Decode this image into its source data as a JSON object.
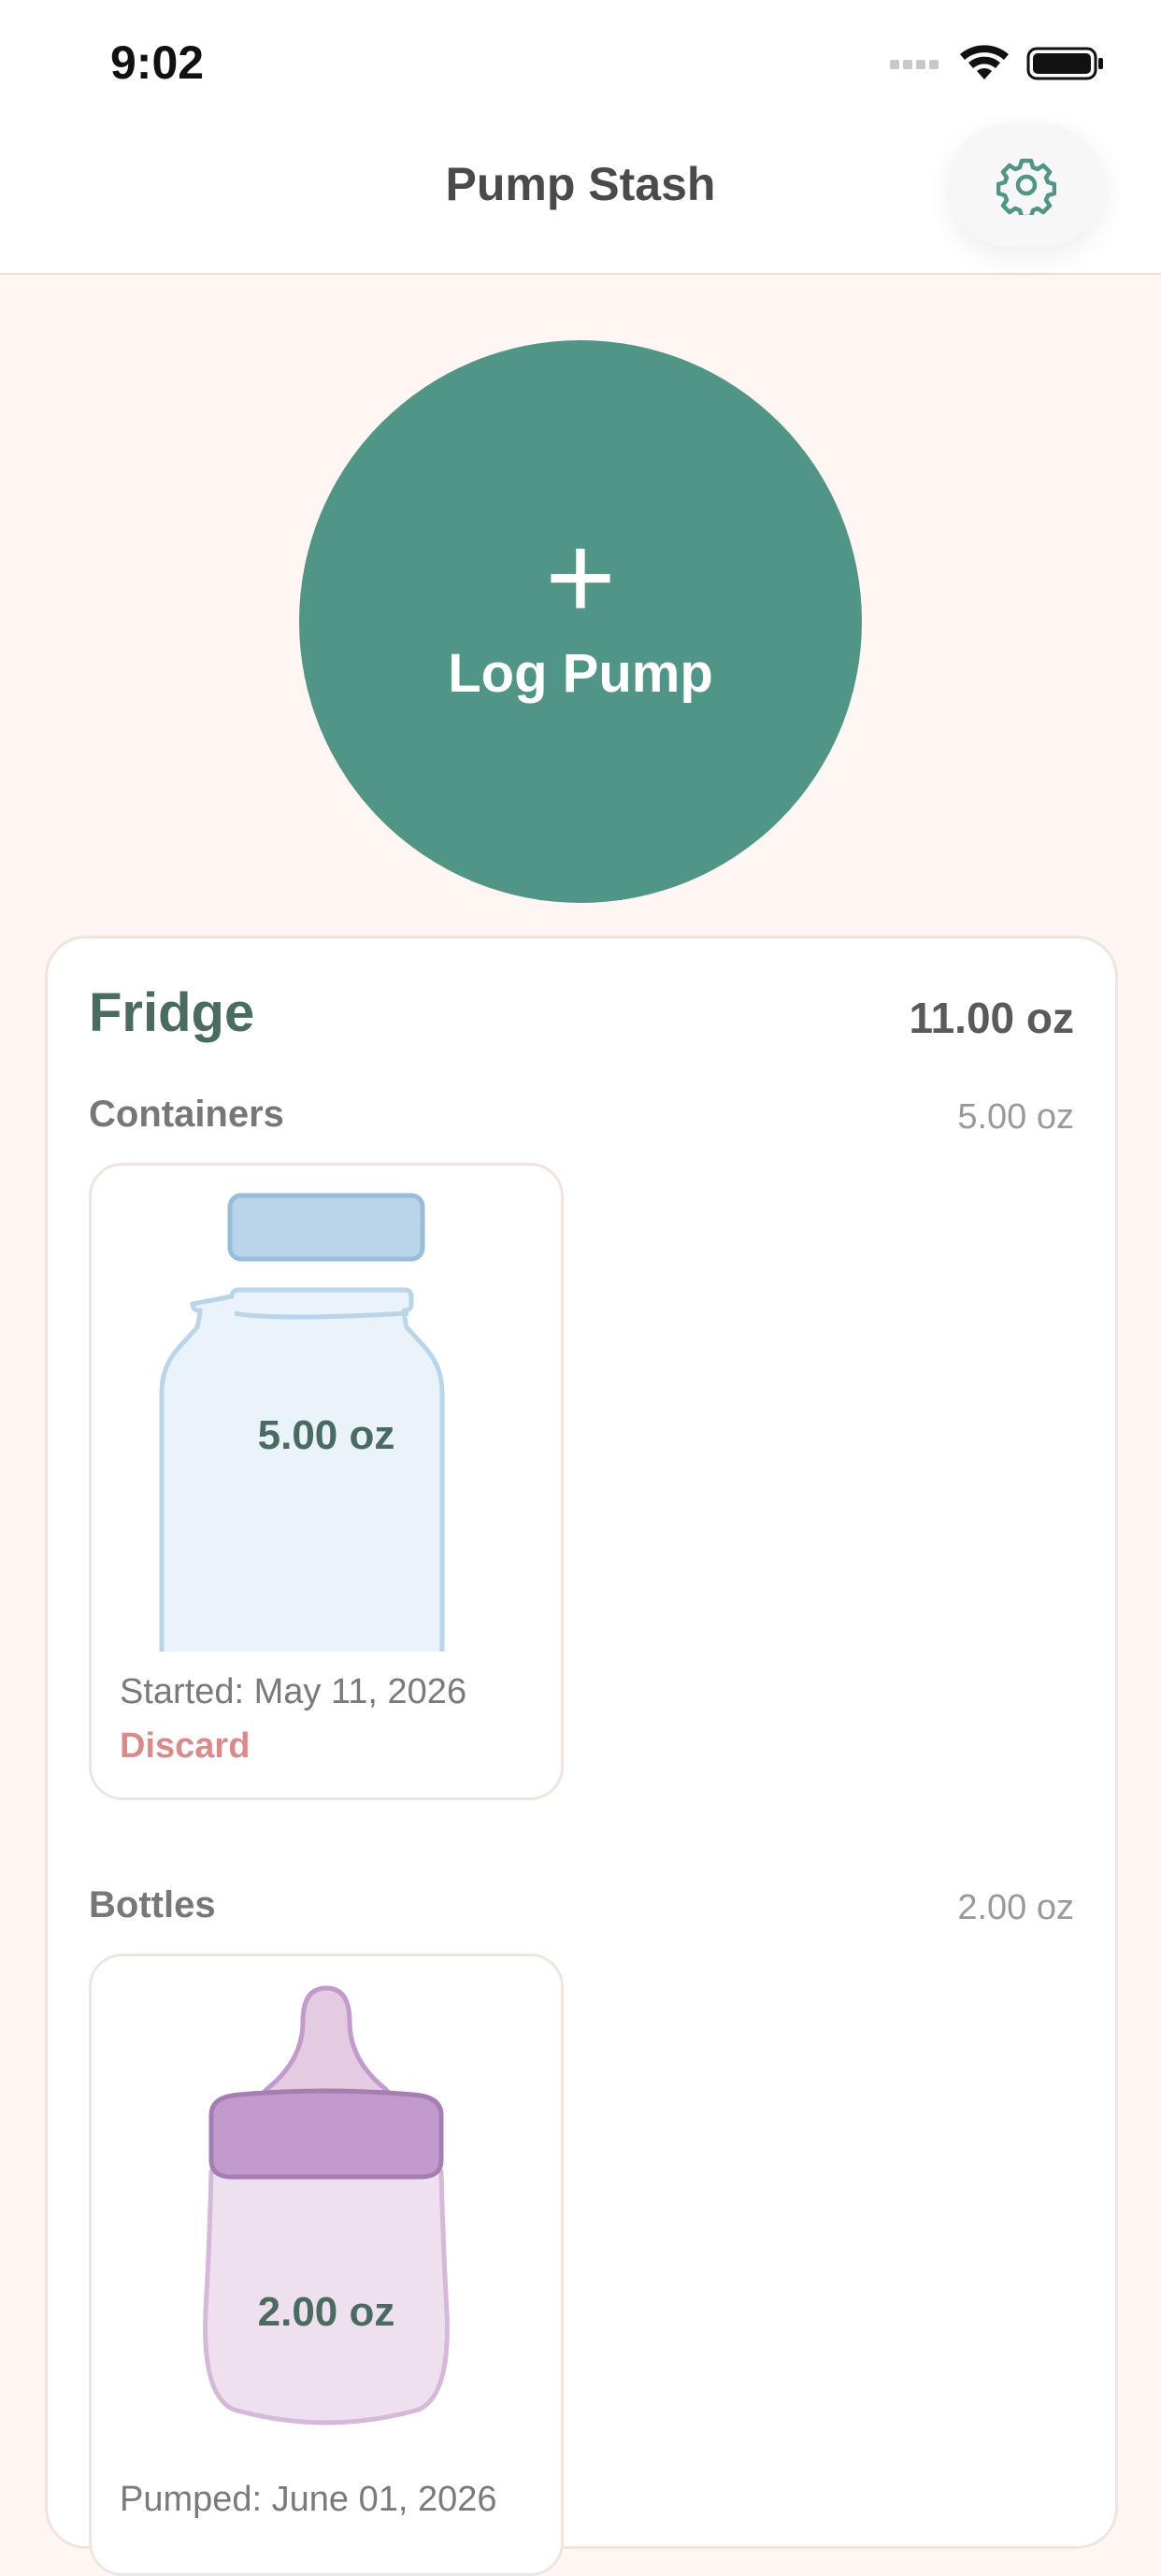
{
  "status_bar": {
    "time": "9:02"
  },
  "nav": {
    "title": "Pump Stash",
    "settings_icon": "gear-icon"
  },
  "log_button": {
    "icon": "+",
    "label": "Log Pump"
  },
  "fridge": {
    "title": "Fridge",
    "total": "11.00 oz",
    "sections": [
      {
        "label": "Containers",
        "total": "5.00 oz",
        "items": [
          {
            "amount": "5.00 oz",
            "date": "Started: May 11, 2026",
            "action": "Discard",
            "icon": "container-jar-icon"
          }
        ]
      },
      {
        "label": "Bottles",
        "total": "2.00 oz",
        "items": [
          {
            "amount": "2.00 oz",
            "date": "Pumped: June 01, 2026",
            "icon": "baby-bottle-icon"
          }
        ]
      }
    ]
  },
  "colors": {
    "accent": "#509586",
    "background": "#FDF6F3",
    "discard": "#D98A8A",
    "jar": "#BAD5EA",
    "bottle": "#C29ACB"
  }
}
